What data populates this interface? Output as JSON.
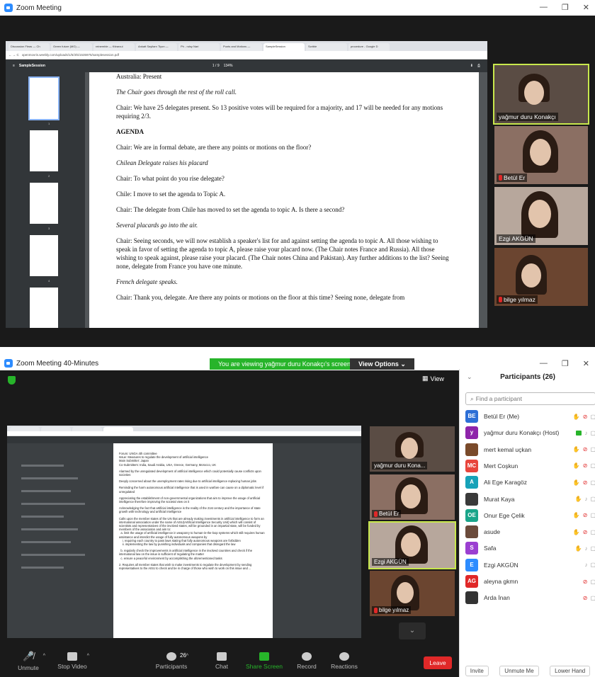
{
  "window1": {
    "title": "Zoom Meeting",
    "controls": [
      "—",
      "❐",
      "✕"
    ],
    "browser_tabs": [
      "Discussion Fleas — Ch",
      "Green future (MO) —",
      "reinemble — Ktirarcui",
      "Ankatt Sayilarn Tiyon —",
      "Ph - rulsy Nari",
      "Punts and Motions —",
      "SampleSession",
      "Scrible",
      "procedure - Google D"
    ],
    "address": "openmovris.weebly.com/uploads/1/5/3/5/1535975/samplesession.pdf",
    "pdf_title": "SampleSession",
    "pdf_page": "1 / 9",
    "pdf_zoom": "134%",
    "thumb_numbers": [
      "1",
      "2",
      "3",
      "4",
      "5"
    ],
    "page_lines": [
      {
        "text": "Australia: Present",
        "style": ""
      },
      {
        "text": "The Chair goes through the rest of the roll call.",
        "style": "it"
      },
      {
        "text": "Chair:  We have 25 delegates present.  So 13 positive votes will be required for a majority, and 17 will be needed for any motions requiring 2/3.",
        "style": ""
      },
      {
        "text": "AGENDA",
        "style": "hd"
      },
      {
        "text": "Chair: We are in formal debate, are there any points or motions on the floor?",
        "style": ""
      },
      {
        "text": "Chilean Delegate raises his placard",
        "style": "it"
      },
      {
        "text": "Chair: To what point do you rise delegate?",
        "style": ""
      },
      {
        "text": "Chile: I move to set the agenda to Topic A.",
        "style": ""
      },
      {
        "text": "Chair: The delegate from Chile has moved to set the agenda to topic A.  Is there a second?",
        "style": ""
      },
      {
        "text": "Several placards go into the air.",
        "style": "it"
      },
      {
        "text": "Chair:  Seeing seconds, we will now establish a speaker's list for and against setting the agenda to topic A.  All those wishing to speak in favor of setting the agenda to topic A, please raise your placard now.  (The Chair notes France and Russia).  All those wishing to speak against, please raise your placard.  (The Chair notes China and Pakistan).  Any further additions to the list?  Seeing none, delegate from France you have one minute.",
        "style": ""
      },
      {
        "text": "French delegate speaks.",
        "style": "it"
      },
      {
        "text": "Chair: Thank you, delegate.  Are there any points or motions on the floor at this time?  Seeing none, delegate from",
        "style": ""
      }
    ],
    "gallery": [
      {
        "name": "yağmur duru Konakçı",
        "muted": false,
        "active": true
      },
      {
        "name": "Betül Er",
        "muted": true,
        "active": false
      },
      {
        "name": "Ezgi AKGÜN",
        "muted": false,
        "active": false
      },
      {
        "name": "bilge yılmaz",
        "muted": true,
        "active": false
      }
    ]
  },
  "window2": {
    "title": "Zoom Meeting 40-Minutes",
    "viewing_banner": "You are viewing yağmur duru Konakçı's screen",
    "view_options": "View Options ⌄",
    "view_label": "View",
    "doc_lines": [
      "Forum: UNGA 4th committee\nIssue: Measures to regulate the development of artificial intelligence\nMain Submitter: Japan\nCo-Submitters: India, Saudi Arabia, USA, Greece, Germany, Morocco, UK",
      "Alarmed by the unregulated development of artificial intelligence which could potentially cause conflicts upon societies",
      "Deeply concerned about the unemployment rates rising due to artificial intelligence replacing human jobs",
      "Reminding the harm autonomous artificial intelligence that is used in warfare can cause on a diplomatic level if unregulated",
      "Appreciating the establishment of non-governmental organizations that aim to improve the usage of artificial intelligence therefore improving the societal view on it",
      "Acknowledging the fact that artificial intelligence is the reality of the 21st century and the importance of state growth with technology and artificial intelligence",
      "Calls upon the member states of the UN that are already making investments in artificial intelligence to form an international association under the name of AISU(Artificial Intelligence Security Unit) which will consist of scientists and representatives of the involved states, will be grounded in an impartial state, will be funded by members of the association and aim to:\n  a. limit the usage of artificial intelligence in weaponry to human-in-the-loop systems which still requires human assistance and interdict the usage of fully autonomous weapons by\n    i. requiring each country to pass laws stating that fully autonomous weapons are forbidden\n    ii. implementing the law by punishing individuals and companies that disregard the law",
      "  b. regularly check the improvements in artificial intelligence in the involved countries and check if the international law on the issue is sufficient of regulating the matter\n  c. ensure a peaceful environment by accomplishing the aforementioned tasks",
      "2. Requires all member states that wish to make investments to regulate the development by sending representatives to the AISU to check and be in charge of those who wish to work on this issue and ..."
    ],
    "gallery": [
      {
        "name": "yağmur duru Kona...",
        "muted": false,
        "active": false
      },
      {
        "name": "Betül Er",
        "muted": true,
        "active": false
      },
      {
        "name": "Ezgi AKGÜN",
        "muted": false,
        "active": true
      },
      {
        "name": "bilge yılmaz",
        "muted": true,
        "active": false
      }
    ],
    "toolbar": {
      "unmute": "Unmute",
      "stop_video": "Stop Video",
      "participants": "Participants",
      "participants_count": "26",
      "chat": "Chat",
      "share_screen": "Share Screen",
      "record": "Record",
      "reactions": "Reactions",
      "leave": "Leave"
    },
    "participants_panel": {
      "title": "Participants (26)",
      "search_placeholder": "Find a participant",
      "list": [
        {
          "initials": "BE",
          "color": "#2d6fd6",
          "name": "Betül Er (Me)",
          "hand": true,
          "mic": "off",
          "sharing": false
        },
        {
          "initials": "y",
          "color": "#8e24aa",
          "name": "yağmur duru Konakçı (Host)",
          "hand": false,
          "mic": "on",
          "sharing": true
        },
        {
          "initials": "",
          "color": "#7a4a2a",
          "name": "mert kemal uçkan",
          "hand": true,
          "mic": "off",
          "sharing": false
        },
        {
          "initials": "MC",
          "color": "#e8453c",
          "name": "Mert Coşkun",
          "hand": true,
          "mic": "off",
          "sharing": false
        },
        {
          "initials": "A",
          "color": "#17a2b8",
          "name": "Ali Ege Karagöz",
          "hand": true,
          "mic": "off",
          "sharing": false
        },
        {
          "initials": "",
          "color": "#3a3a3a",
          "name": "Murat Kaya",
          "hand": true,
          "mic": "on",
          "sharing": false
        },
        {
          "initials": "OE",
          "color": "#1aa58a",
          "name": "Onur Ege Çelik",
          "hand": true,
          "mic": "off",
          "sharing": false
        },
        {
          "initials": "",
          "color": "#6b4b3b",
          "name": "asude",
          "hand": true,
          "mic": "off",
          "sharing": false
        },
        {
          "initials": "S",
          "color": "#9b3fd1",
          "name": "Safa",
          "hand": true,
          "mic": "on",
          "sharing": false
        },
        {
          "initials": "E",
          "color": "#2d8cff",
          "name": "Ezgi AKGÜN",
          "hand": false,
          "mic": "on",
          "sharing": false
        },
        {
          "initials": "AG",
          "color": "#e02828",
          "name": "aleyna gkmn",
          "hand": false,
          "mic": "off",
          "sharing": false
        },
        {
          "initials": "",
          "color": "#333333",
          "name": "Arda İnan",
          "hand": false,
          "mic": "off",
          "sharing": false
        }
      ],
      "footer": [
        "Invite",
        "Unmute Me",
        "Lower Hand"
      ]
    }
  }
}
